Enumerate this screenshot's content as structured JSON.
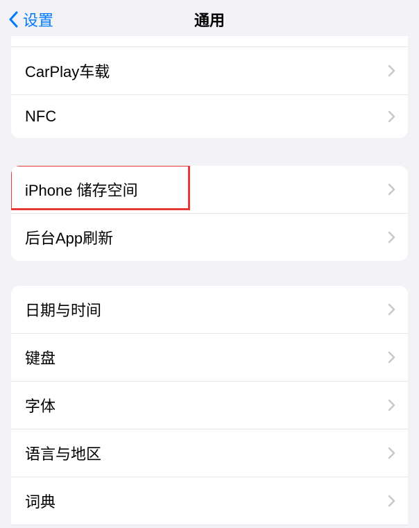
{
  "nav": {
    "back_label": "设置",
    "title": "通用"
  },
  "group1": {
    "items": [
      {
        "label": "CarPlay车载"
      },
      {
        "label": "NFC"
      }
    ]
  },
  "group2": {
    "items": [
      {
        "label": "iPhone 储存空间"
      },
      {
        "label": "后台App刷新"
      }
    ]
  },
  "group3": {
    "items": [
      {
        "label": "日期与时间"
      },
      {
        "label": "键盘"
      },
      {
        "label": "字体"
      },
      {
        "label": "语言与地区"
      },
      {
        "label": "词典"
      }
    ]
  }
}
